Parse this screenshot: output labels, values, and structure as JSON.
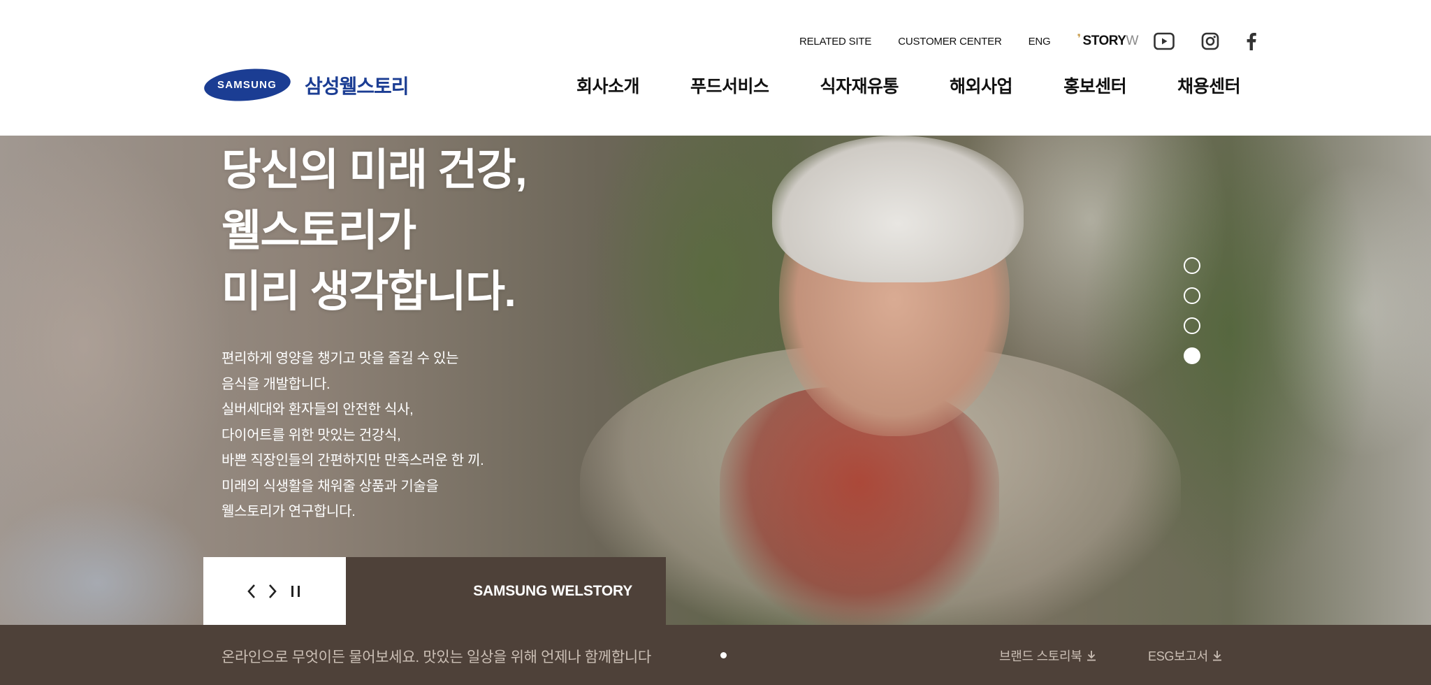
{
  "header": {
    "util_links": [
      "RELATED SITE",
      "CUSTOMER CENTER",
      "ENG"
    ],
    "storyw": {
      "main": "STORY",
      "suffix": "W"
    },
    "social_icons": [
      "youtube-icon",
      "instagram-icon",
      "facebook-icon"
    ],
    "logo": {
      "mark": "SAMSUNG",
      "name": "삼성웰스토리"
    },
    "nav": [
      "회사소개",
      "푸드서비스",
      "식자재유통",
      "해외사업",
      "홍보센터",
      "채용센터"
    ]
  },
  "hero": {
    "title_lines": [
      "당신의 미래 건강,",
      "웰스토리가",
      "미리 생각합니다."
    ],
    "desc_lines": [
      "편리하게 영양을 챙기고 맛을 즐길 수 있는",
      "음식을 개발합니다.",
      "실버세대와 환자들의 안전한 식사,",
      "다이어트를 위한 맛있는 건강식,",
      "바쁜 직장인들의 간편하지만 만족스러운 한 끼.",
      "미래의 식생활을 채워줄 상품과 기술을",
      "웰스토리가 연구합니다."
    ],
    "slide_count": 4,
    "active_slide": 4,
    "brand_label": "SAMSUNG WELSTORY"
  },
  "bottom": {
    "ticker": "온라인으로 무엇이든 물어보세요. 맛있는 일상을 위해 언제나 함께합니다",
    "downloads": [
      "브랜드 스토리북",
      "ESG보고서"
    ]
  },
  "colors": {
    "brand_blue": "#1b3d93",
    "brown": "#4e4139",
    "muted_text": "#cbbfb5"
  }
}
